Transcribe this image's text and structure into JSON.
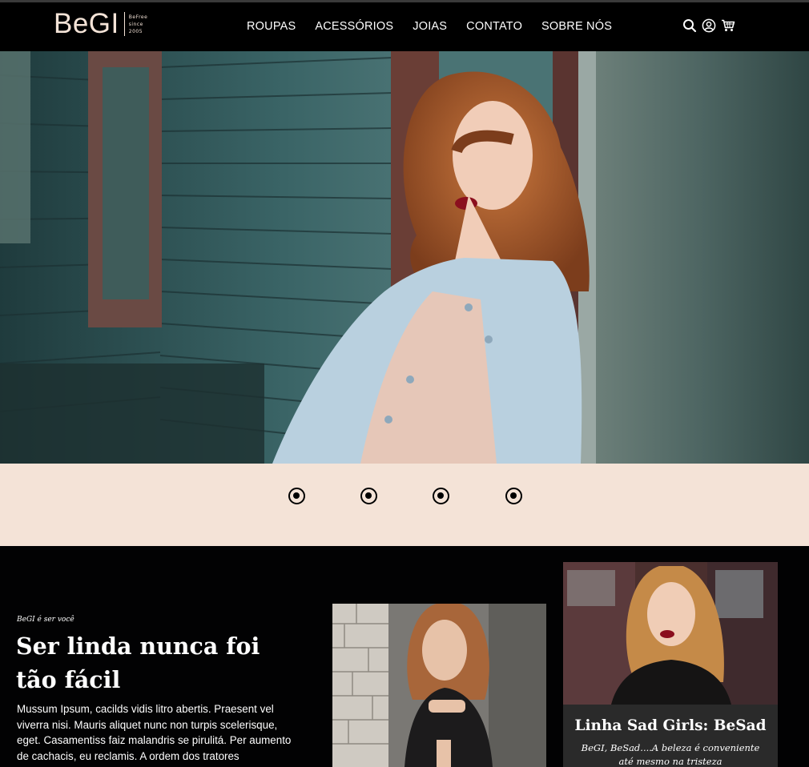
{
  "brand": {
    "name": "BeGI",
    "tagline": [
      "BeFree",
      "since",
      "2005"
    ],
    "accent": "#f4e3d7"
  },
  "nav": {
    "items": [
      "ROUPAS",
      "ACESSÓRIOS",
      "JOIAS",
      "CONTATO",
      "SOBRE NÓS"
    ]
  },
  "header_icons": [
    "search-icon",
    "user-icon",
    "cart-icon"
  ],
  "carousel": {
    "slide_count": 4,
    "active_index": 0
  },
  "intro": {
    "eyebrow": "BeGI é ser você",
    "headline": "Ser linda nunca foi tão fácil",
    "body": "Mussum Ipsum, cacilds vidis litro abertis. Praesent vel viverra nisi. Mauris aliquet nunc non turpis scelerisque, eget. Casamentiss faiz malandris se pirulitá. Per aumento de cachacis, eu reclamis. A ordem dos tratores"
  },
  "feature_card": {
    "title": "Linha Sad Girls: BeSad",
    "description": "BeGI, BeSad....A beleza é conveniente até mesmo na tristeza"
  },
  "colors": {
    "background": "#000000",
    "peach": "#f4e3d7",
    "card": "#2a2a2a"
  }
}
